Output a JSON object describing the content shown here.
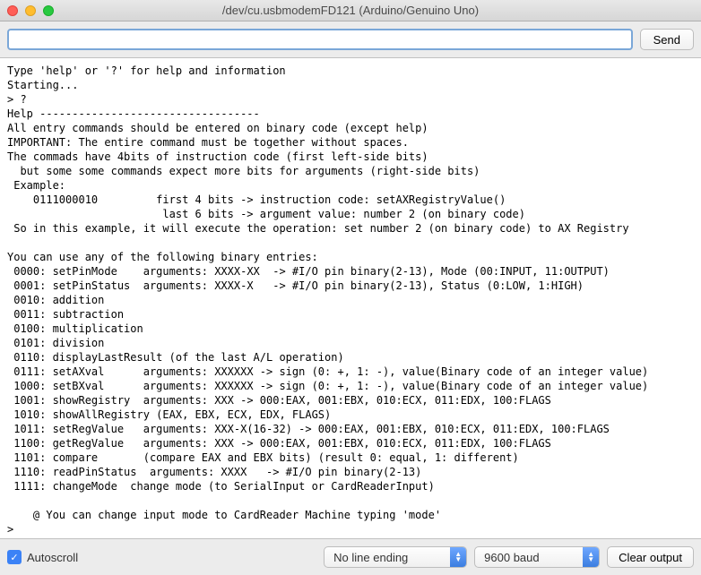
{
  "window": {
    "title": "/dev/cu.usbmodemFD121 (Arduino/Genuino Uno)"
  },
  "toolbar": {
    "send_label": "Send",
    "input_value": ""
  },
  "console_text": "Type 'help' or '?' for help and information\nStarting...\n> ?\nHelp ----------------------------------\nAll entry commands should be entered on binary code (except help)\nIMPORTANT: The entire command must be together without spaces.\nThe commads have 4bits of instruction code (first left-side bits)\n  but some some commands expect more bits for arguments (right-side bits)\n Example:\n    0111000010         first 4 bits -> instruction code: setAXRegistryValue()\n                        last 6 bits -> argument value: number 2 (on binary code)\n So in this example, it will execute the operation: set number 2 (on binary code) to AX Registry\n\nYou can use any of the following binary entries:\n 0000: setPinMode    arguments: XXXX-XX  -> #I/O pin binary(2-13), Mode (00:INPUT, 11:OUTPUT)\n 0001: setPinStatus  arguments: XXXX-X   -> #I/O pin binary(2-13), Status (0:LOW, 1:HIGH)\n 0010: addition\n 0011: subtraction\n 0100: multiplication\n 0101: division\n 0110: displayLastResult (of the last A/L operation)\n 0111: setAXval      arguments: XXXXXX -> sign (0: +, 1: -), value(Binary code of an integer value)\n 1000: setBXval      arguments: XXXXXX -> sign (0: +, 1: -), value(Binary code of an integer value)\n 1001: showRegistry  arguments: XXX -> 000:EAX, 001:EBX, 010:ECX, 011:EDX, 100:FLAGS\n 1010: showAllRegistry (EAX, EBX, ECX, EDX, FLAGS)\n 1011: setRegValue   arguments: XXX-X(16-32) -> 000:EAX, 001:EBX, 010:ECX, 011:EDX, 100:FLAGS\n 1100: getRegValue   arguments: XXX -> 000:EAX, 001:EBX, 010:ECX, 011:EDX, 100:FLAGS\n 1101: compare       (compare EAX and EBX bits) (result 0: equal, 1: different)\n 1110: readPinStatus  arguments: XXXX   -> #I/O pin binary(2-13)\n 1111: changeMode  change mode (to SerialInput or CardReaderInput)\n\n    @ You can change input mode to CardReader Machine typing 'mode'\n>",
  "bottom": {
    "autoscroll_label": "Autoscroll",
    "autoscroll_checked": true,
    "line_ending": "No line ending",
    "baud": "9600 baud",
    "clear_label": "Clear output"
  }
}
